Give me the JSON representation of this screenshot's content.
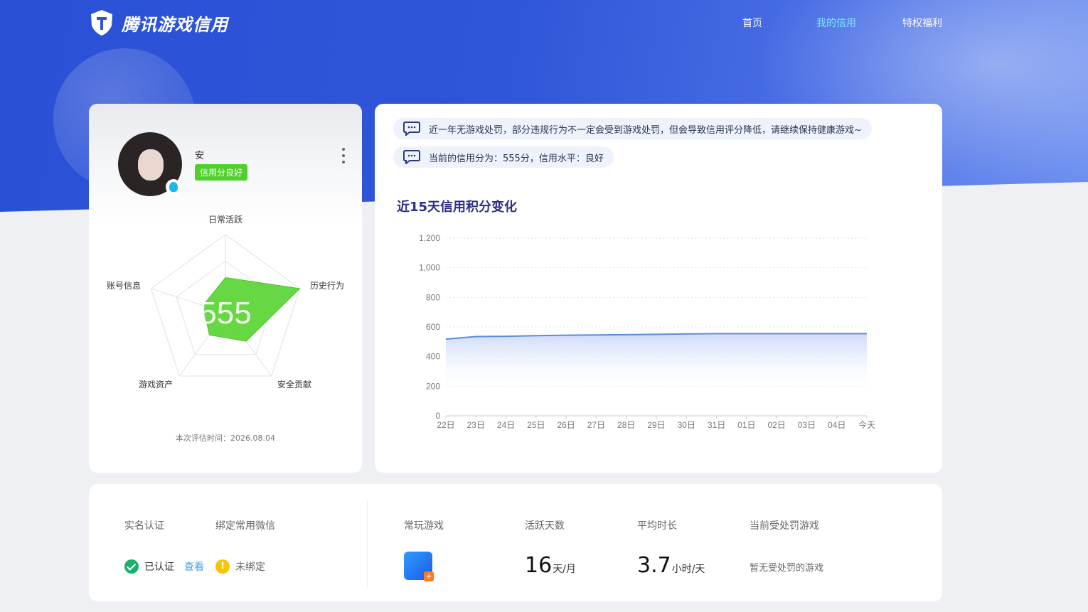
{
  "header": {
    "logo_text": "腾讯游戏信用",
    "nav": [
      {
        "label": "首页",
        "active": false
      },
      {
        "label": "我的信用",
        "active": true
      },
      {
        "label": "特权福利",
        "active": false
      }
    ]
  },
  "profile": {
    "name": "安",
    "badge": "信用分良好",
    "score": "555",
    "radar_labels": [
      "日常活跃",
      "历史行为",
      "安全贡献",
      "游戏资产",
      "账号信息"
    ],
    "radar_values": [
      0.45,
      1.0,
      0.45,
      0.35,
      0.3
    ],
    "eval_time": "本次评估时间：2026.08.04"
  },
  "notices": [
    "近一年无游戏处罚，部分违规行为不一定会受到游戏处罚，但会导致信用评分降低，请继续保持健康游戏~",
    "当前的信用分为：555分，信用水平：良好"
  ],
  "chart_title": "近15天信用积分变化",
  "chart_data": {
    "type": "area",
    "x": [
      "22日",
      "23日",
      "24日",
      "25日",
      "26日",
      "27日",
      "28日",
      "29日",
      "30日",
      "31日",
      "01日",
      "02日",
      "03日",
      "04日",
      "今天"
    ],
    "y_ticks": [
      "0",
      "200",
      "400",
      "600",
      "800",
      "1,000",
      "1,200"
    ],
    "ylim": [
      0,
      1200
    ],
    "series": [
      {
        "values": [
          518,
          535,
          537,
          541,
          544,
          546,
          548,
          550,
          553,
          555,
          555,
          555,
          555,
          555,
          555
        ]
      }
    ],
    "grid": "horizontal dotted",
    "color": "#5b8be0"
  },
  "bottom": {
    "real_name_label": "实名认证",
    "wechat_label": "绑定常用微信",
    "verified_text": "已认证",
    "view_link": "查看",
    "unbound_text": "未绑定",
    "common_game_label": "常玩游戏",
    "active_days_label": "活跃天数",
    "active_days_value": "16",
    "active_days_unit": "天/月",
    "avg_time_label": "平均时长",
    "avg_time_value": "3.7",
    "avg_time_unit": "小时/天",
    "punished_label": "当前受处罚游戏",
    "punished_value": "暂无受处罚的游戏"
  }
}
